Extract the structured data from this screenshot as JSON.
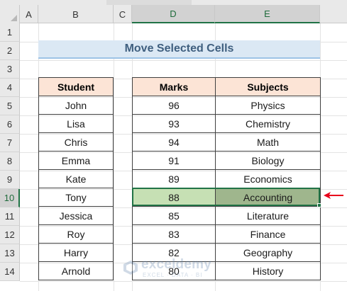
{
  "columns": [
    "A",
    "B",
    "C",
    "D",
    "E"
  ],
  "rows": [
    "1",
    "2",
    "3",
    "4",
    "5",
    "6",
    "7",
    "8",
    "9",
    "10",
    "11",
    "12",
    "13",
    "14"
  ],
  "title": "Move Selected Cells",
  "student_table": {
    "header": "Student",
    "names": [
      "John",
      "Lisa",
      "Chris",
      "Emma",
      "Kate",
      "Tony",
      "Jessica",
      "Roy",
      "Harry",
      "Arnold"
    ]
  },
  "marks_table": {
    "headers": [
      "Marks",
      "Subjects"
    ],
    "rows": [
      {
        "marks": "96",
        "subject": "Physics"
      },
      {
        "marks": "93",
        "subject": "Chemistry"
      },
      {
        "marks": "94",
        "subject": "Math"
      },
      {
        "marks": "91",
        "subject": "Biology"
      },
      {
        "marks": "89",
        "subject": "Economics"
      },
      {
        "marks": "88",
        "subject": "Accounting"
      },
      {
        "marks": "85",
        "subject": "Literature"
      },
      {
        "marks": "83",
        "subject": "Finance"
      },
      {
        "marks": "82",
        "subject": "Geography"
      },
      {
        "marks": "80",
        "subject": "History"
      }
    ]
  },
  "selection": {
    "row": "10",
    "columns": [
      "D",
      "E"
    ]
  },
  "watermark": {
    "name": "exceldemy",
    "tagline": "EXCEL · DATA · BI"
  },
  "colors": {
    "selection_border": "#217346",
    "header_fill": "#fce4d6",
    "title_fill": "#dbe8f4",
    "selected_marks_fill": "#c6e0b4",
    "selected_subject_fill": "#9fb68d",
    "arrow": "#e8001c"
  },
  "icons": {
    "pointer": "red-arrow-icon",
    "logo": "exceldemy-logo-icon"
  }
}
